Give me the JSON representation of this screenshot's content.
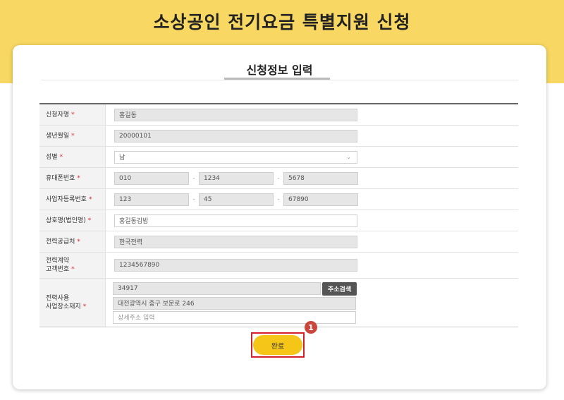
{
  "header": {
    "title": "소상공인 전기요금 특별지원 신청"
  },
  "section": {
    "title": "신청정보 입력"
  },
  "form": {
    "applicant_name": {
      "label": "신청자명",
      "value": "홍길동"
    },
    "birth_date": {
      "label": "생년월일",
      "value": "20000101"
    },
    "gender": {
      "label": "성별",
      "value": "남"
    },
    "phone": {
      "label": "휴대폰번호",
      "part1": "010",
      "part2": "1234",
      "part3": "5678",
      "separator": "-"
    },
    "business_no": {
      "label": "사업자등록번호",
      "part1": "123",
      "part2": "45",
      "part3": "67890",
      "separator": "-"
    },
    "company_name": {
      "label": "상호명(법인명)",
      "value": "홍길동김밥"
    },
    "power_supplier": {
      "label": "전력공급처",
      "value": "한국전력"
    },
    "customer_no": {
      "label_line1": "전력계약",
      "label_line2": "고객번호",
      "value": "1234567890"
    },
    "address": {
      "label_line1": "전력사용",
      "label_line2": "사업장소재지",
      "zip": "34917",
      "search_label": "주소검색",
      "road_address": "대전광역시 중구 보문로 246",
      "detail_placeholder": "상세주소 입력"
    },
    "required_mark": "*"
  },
  "actions": {
    "done_label": "완료",
    "step_number": "1"
  },
  "colors": {
    "band": "#f8d862",
    "button": "#f5c518",
    "highlight": "#d4202a",
    "required": "#e0262a"
  }
}
